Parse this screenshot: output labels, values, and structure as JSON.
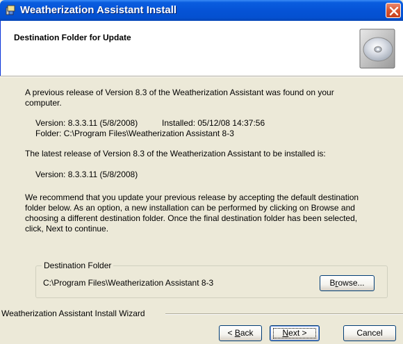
{
  "window": {
    "title": "Weatherization Assistant Install",
    "icon": "installer-icon",
    "close_icon": "close-icon"
  },
  "header": {
    "title": "Destination Folder for Update",
    "icon": "cd-disc-icon"
  },
  "body": {
    "para1_line1": "A previous release of Version 8.3 of the Weatherization Assistant was found on your",
    "para1_line2": "computer.",
    "prev_version": "Version: 8.3.3.11 (5/8/2008)",
    "prev_installed": "Installed: 05/12/08 14:37:56",
    "prev_folder": "Folder: C:\\Program Files\\Weatherization Assistant 8-3",
    "para2": "The latest release of Version 8.3 of the Weatherization Assistant to be installed is:",
    "new_version": "Version: 8.3.3.11 (5/8/2008)",
    "para3_line1": "We recommend that you update your previous release by accepting the default destination",
    "para3_line2": "folder below.  As an option, a new installation can be performed by clicking on Browse and",
    "para3_line3": "choosing a different destination folder.  Once the final destination folder has been selected,",
    "para3_line4": "click, Next to continue."
  },
  "destination": {
    "group_label": "Destination Folder",
    "path": "C:\\Program Files\\Weatherization Assistant 8-3",
    "browse_pre": "B",
    "browse_mnemonic": "r",
    "browse_post": "owse..."
  },
  "footer": {
    "wizard_label": "Weatherization Assistant Install Wizard",
    "back_pre": "< ",
    "back_mnemonic": "B",
    "back_post": "ack",
    "next_mnemonic": "N",
    "next_post": "ext >",
    "cancel_label": "Cancel"
  },
  "colors": {
    "titlebar": "#0553d6",
    "dialog_face": "#ece9d8",
    "button_border": "#003c74",
    "close_button": "#d8542e"
  }
}
